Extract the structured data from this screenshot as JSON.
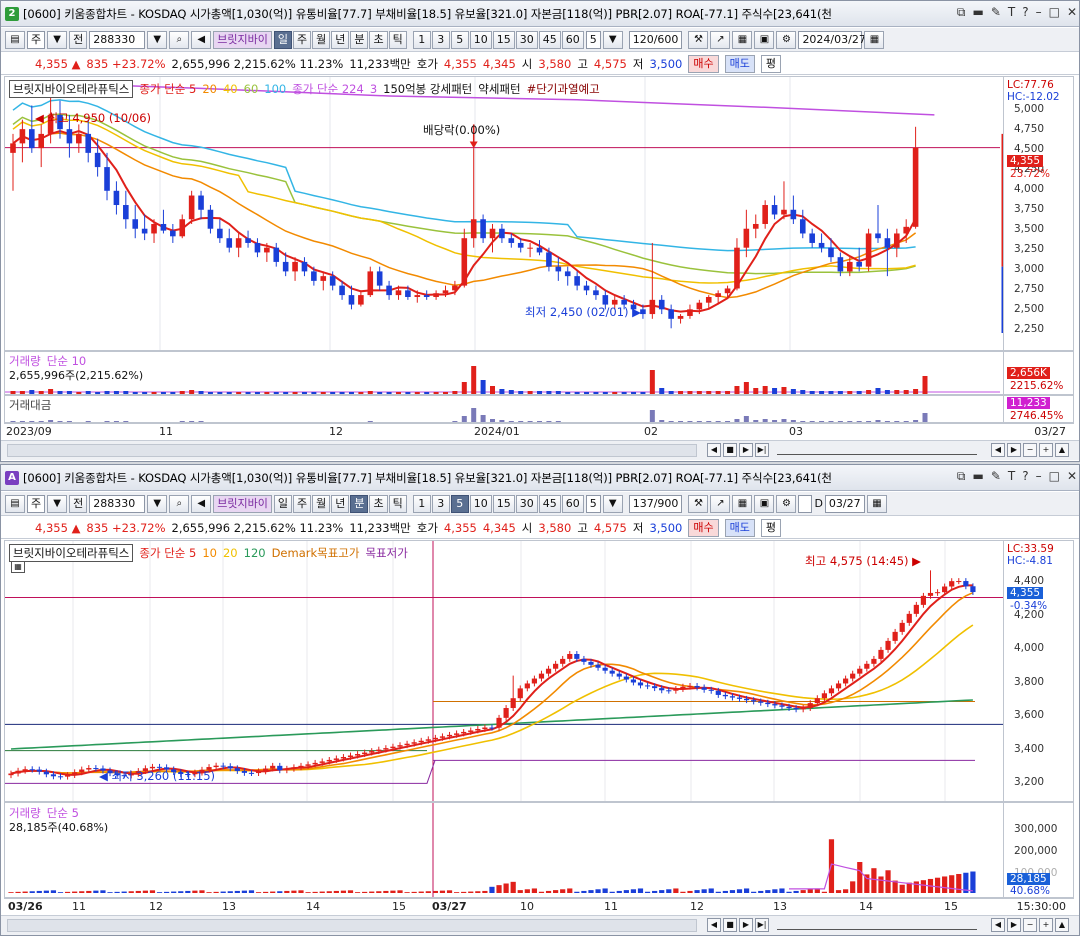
{
  "w1": {
    "badge": "2",
    "title": "[0600] 키움종합차트 - KOSDAQ 시가총액[1,030(억)] 유통비율[77.7] 부채비율[18.5] 유보율[321.0] 자본금[118(억)] PBR[2.07] ROA[-77.1] 주식수[23,641(천",
    "toolbar": {
      "type": "주",
      "prev": "전",
      "code": "288330",
      "name": "브릿지바이",
      "periods": [
        "일",
        "주",
        "월",
        "년",
        "분",
        "초",
        "틱"
      ],
      "active_period": "일",
      "nums": [
        "1",
        "3",
        "5",
        "10",
        "15",
        "30",
        "45",
        "60"
      ],
      "count_sel": "5",
      "bars": "120/600",
      "date": "2024/03/27"
    },
    "quote": {
      "price": "4,355 ▲",
      "change": "835 +23.72%",
      "volume": "2,655,996 2,215.62% 11.23%",
      "amount": "11,233백만",
      "hoga_label": "호가",
      "ask": "4,355",
      "bid": "4,345",
      "open_label": "시",
      "open": "3,580",
      "high_label": "고",
      "high": "4,575",
      "low_label": "저",
      "low": "3,500",
      "buy": "매수",
      "sell": "매도",
      "eval": "평"
    },
    "legend": {
      "name": "브릿지바이오테라퓨틱스",
      "ma": "종가 단순 5",
      "p20": "20",
      "p40": "40",
      "p60": "60",
      "p100": "100",
      "ma224": "종가 단순 224",
      "p3": "3",
      "pattern1": "150억봉 강세패턴",
      "pattern2": "약세패턴",
      "pattern3": "#단기과열예고"
    },
    "annotations": {
      "high": "최고 4,950 (10/06)",
      "low": "최저 2,450 (02/01)",
      "div": "배당락(0.00%)"
    },
    "yaxis": {
      "lc": "LC:77.76",
      "hc": "HC:-12.02",
      "labels": [
        "5,000",
        "4,750",
        "4,500",
        "4,250",
        "4,000",
        "3,750",
        "3,500",
        "3,250",
        "3,000",
        "2,750",
        "2,500",
        "2,250"
      ],
      "cur": "4,355",
      "pct": "23.72%"
    },
    "vol": {
      "title": "거래량",
      "ma": "단순 10",
      "val": "2,655,996주(2,215.62%)",
      "tag": "2,656K",
      "tagpct": "2215.62%"
    },
    "amt": {
      "title": "거래대금",
      "tag": "11,233",
      "tagpct": "2746.45%"
    },
    "xaxis": [
      "2023/09",
      "11",
      "12",
      "2024/01",
      "02",
      "03"
    ],
    "xend": "03/27",
    "colors": {
      "up": "#e0201a",
      "down": "#1a3fd8",
      "ma5": "#e0201a",
      "ma20": "#f28a00",
      "ma40": "#f0c000",
      "ma60": "#9ac23c",
      "ma100": "#33b5e5",
      "ma224": "#c050e0"
    },
    "candles": [
      [
        2023,
        4300,
        4500,
        3900,
        4400
      ],
      [
        1,
        4400,
        4650,
        4200,
        4550
      ],
      [
        1,
        4550,
        4800,
        4300,
        4350
      ],
      [
        1,
        4350,
        4600,
        4150,
        4500
      ],
      [
        1,
        4500,
        4950,
        4400,
        4700
      ],
      [
        1,
        4700,
        4850,
        4450,
        4550
      ],
      [
        1,
        4550,
        4700,
        4250,
        4400
      ],
      [
        1,
        4400,
        4600,
        4300,
        4500
      ],
      [
        1,
        4500,
        4650,
        4200,
        4300
      ],
      [
        1,
        4300,
        4450,
        4050,
        4150
      ],
      [
        1,
        4150,
        4300,
        3800,
        3900
      ],
      [
        1,
        3900,
        4000,
        3650,
        3750
      ],
      [
        1,
        3750,
        3900,
        3500,
        3600
      ],
      [
        1,
        3600,
        3750,
        3400,
        3500
      ],
      [
        1,
        3500,
        3650,
        3380,
        3450
      ],
      [
        1,
        3450,
        3600,
        3350,
        3550
      ],
      [
        1,
        3550,
        3700,
        3450,
        3480
      ],
      [
        1,
        3480,
        3550,
        3350,
        3420
      ],
      [
        1,
        3420,
        3650,
        3400,
        3600
      ],
      [
        1,
        3600,
        3900,
        3550,
        3850
      ],
      [
        1,
        3850,
        3900,
        3600,
        3700
      ],
      [
        1,
        3700,
        3750,
        3450,
        3500
      ],
      [
        1,
        3500,
        3600,
        3350,
        3400
      ],
      [
        1,
        3400,
        3500,
        3250,
        3300
      ],
      [
        1,
        3300,
        3450,
        3200,
        3400
      ],
      [
        1,
        3400,
        3480,
        3300,
        3350
      ],
      [
        1,
        3350,
        3400,
        3200,
        3250
      ],
      [
        1,
        3250,
        3350,
        3150,
        3300
      ],
      [
        1,
        3300,
        3350,
        3100,
        3150
      ],
      [
        1,
        3150,
        3250,
        3000,
        3050
      ],
      [
        1,
        3050,
        3200,
        2950,
        3150
      ],
      [
        1,
        3150,
        3200,
        3000,
        3050
      ],
      [
        1,
        3050,
        3100,
        2900,
        2950
      ],
      [
        1,
        2950,
        3050,
        2850,
        3000
      ],
      [
        1,
        3000,
        3050,
        2850,
        2900
      ],
      [
        1,
        2900,
        2950,
        2750,
        2800
      ],
      [
        1,
        2800,
        2900,
        2650,
        2700
      ],
      [
        1,
        2700,
        2850,
        2680,
        2800
      ],
      [
        1,
        2800,
        3100,
        2780,
        3050
      ],
      [
        1,
        3050,
        3100,
        2850,
        2900
      ],
      [
        1,
        2900,
        2950,
        2750,
        2800
      ],
      [
        1,
        2800,
        2900,
        2750,
        2850
      ],
      [
        1,
        2850,
        2900,
        2750,
        2780
      ],
      [
        1,
        2780,
        2850,
        2720,
        2800
      ],
      [
        1,
        2800,
        2850,
        2750,
        2780
      ],
      [
        1,
        2780,
        2850,
        2750,
        2820
      ],
      [
        1,
        2820,
        2900,
        2780,
        2850
      ],
      [
        1,
        2850,
        2950,
        2800,
        2900
      ],
      [
        1,
        2900,
        3500,
        2880,
        3400
      ],
      [
        1,
        3400,
        4350,
        3300,
        3600
      ],
      [
        1,
        3600,
        3650,
        3350,
        3400
      ],
      [
        1,
        3400,
        3550,
        3250,
        3500
      ],
      [
        1,
        3500,
        3550,
        3350,
        3400
      ],
      [
        1,
        3400,
        3450,
        3300,
        3350
      ],
      [
        1,
        3350,
        3400,
        3250,
        3300
      ],
      [
        1,
        3300,
        3350,
        3200,
        3300
      ],
      [
        1,
        3300,
        3380,
        3220,
        3250
      ],
      [
        1,
        3250,
        3300,
        3050,
        3100
      ],
      [
        1,
        3100,
        3200,
        2950,
        3050
      ],
      [
        1,
        3050,
        3100,
        2900,
        3000
      ],
      [
        1,
        3000,
        3050,
        2850,
        2900
      ],
      [
        1,
        2900,
        2950,
        2800,
        2850
      ],
      [
        1,
        2850,
        2900,
        2750,
        2800
      ],
      [
        1,
        2800,
        2850,
        2650,
        2700
      ],
      [
        1,
        2700,
        2800,
        2650,
        2750
      ],
      [
        1,
        2750,
        2800,
        2650,
        2700
      ],
      [
        1,
        2700,
        2750,
        2600,
        2650
      ],
      [
        1,
        2650,
        2700,
        2550,
        2600
      ],
      [
        1,
        2600,
        3350,
        2550,
        2750
      ],
      [
        1,
        2750,
        2800,
        2600,
        2650
      ],
      [
        1,
        2650,
        2700,
        2450,
        2550
      ],
      [
        1,
        2550,
        2600,
        2500,
        2580
      ],
      [
        1,
        2580,
        2700,
        2550,
        2650
      ],
      [
        1,
        2650,
        2750,
        2600,
        2720
      ],
      [
        1,
        2720,
        2800,
        2650,
        2780
      ],
      [
        1,
        2780,
        2850,
        2700,
        2820
      ],
      [
        1,
        2820,
        2900,
        2780,
        2870
      ],
      [
        1,
        2870,
        3400,
        2850,
        3300
      ],
      [
        1,
        3300,
        3700,
        3200,
        3500
      ],
      [
        1,
        3500,
        3650,
        3400,
        3550
      ],
      [
        1,
        3550,
        3800,
        3500,
        3750
      ],
      [
        1,
        3750,
        3850,
        3600,
        3650
      ],
      [
        1,
        3650,
        4000,
        3600,
        3700
      ],
      [
        1,
        3700,
        3850,
        3550,
        3600
      ],
      [
        1,
        3600,
        3700,
        3400,
        3450
      ],
      [
        1,
        3450,
        3500,
        3300,
        3350
      ],
      [
        1,
        3350,
        3450,
        3250,
        3300
      ],
      [
        1,
        3300,
        3400,
        3150,
        3200
      ],
      [
        1,
        3200,
        3250,
        3000,
        3050
      ],
      [
        1,
        3050,
        3200,
        3000,
        3150
      ],
      [
        1,
        3150,
        3300,
        3050,
        3100
      ],
      [
        1,
        3100,
        3500,
        3050,
        3450
      ],
      [
        1,
        3450,
        3750,
        3350,
        3400
      ],
      [
        1,
        3400,
        3500,
        3000,
        3300
      ],
      [
        1,
        3300,
        3500,
        3200,
        3450
      ],
      [
        1,
        3450,
        3600,
        3350,
        3520
      ],
      [
        1,
        3520,
        4575,
        3500,
        4355
      ]
    ],
    "ma224_path": [
      [
        0,
        5050
      ],
      [
        20,
        4980
      ],
      [
        40,
        4900
      ],
      [
        60,
        4860
      ],
      [
        80,
        4780
      ],
      [
        98,
        4700
      ]
    ]
  },
  "w2": {
    "badge": "A",
    "title": "[0600] 키움종합차트 - KOSDAQ 시가총액[1,030(억)] 유통비율[77.7] 부채비율[18.5] 유보율[321.0] 자본금[118(억)] PBR[2.07] ROA[-77.1] 주식수[23,641(천",
    "toolbar": {
      "type": "주",
      "prev": "전",
      "code": "288330",
      "name": "브릿지바이",
      "periods": [
        "일",
        "주",
        "월",
        "년",
        "분",
        "초",
        "틱"
      ],
      "active_period": "분",
      "nums": [
        "1",
        "3",
        "5",
        "10",
        "15",
        "30",
        "45",
        "60"
      ],
      "active_num": "5",
      "count_sel": "5",
      "bars": "137/900",
      "chk": "D",
      "date": "03/27"
    },
    "quote": {
      "price": "4,355 ▲",
      "change": "835 +23.72%",
      "volume": "2,655,996 2,215.62% 11.23%",
      "amount": "11,233백만",
      "hoga_label": "호가",
      "ask": "4,355",
      "bid": "4,345",
      "open_label": "시",
      "open": "3,580",
      "high_label": "고",
      "high": "4,575",
      "low_label": "저",
      "low": "3,500",
      "buy": "매수",
      "sell": "매도",
      "eval": "평"
    },
    "legend": {
      "name": "브릿지바이오테라퓨틱스",
      "ma": "종가 단순 5",
      "p10": "10",
      "p20": "20",
      "p120": "120",
      "demark": "Demark목표고가",
      "demark_low": "목표저가"
    },
    "annotations": {
      "high": "최고 4,575 (14:45)",
      "low": "최저 3,260 (11:15)"
    },
    "yaxis": {
      "lc": "LC:33.59",
      "hc": "HC:-4.81",
      "labels": [
        "4,400",
        "4,200",
        "4,000",
        "3,800",
        "3,600",
        "3,400",
        "3,200"
      ],
      "cur": "4,355",
      "pct": "-0.34%"
    },
    "vol": {
      "title": "거래량",
      "ma": "단순 5",
      "val": "28,185주(40.68%)",
      "labels": [
        "300,000",
        "200,000",
        "100,000"
      ],
      "tag": "28,185",
      "tagpct": "40.68%"
    },
    "xaxis": [
      "03/26",
      "11",
      "12",
      "13",
      "14",
      "15",
      "03/27",
      "10",
      "11",
      "12",
      "13",
      "14",
      "15"
    ],
    "xend": "15:30:00"
  }
}
